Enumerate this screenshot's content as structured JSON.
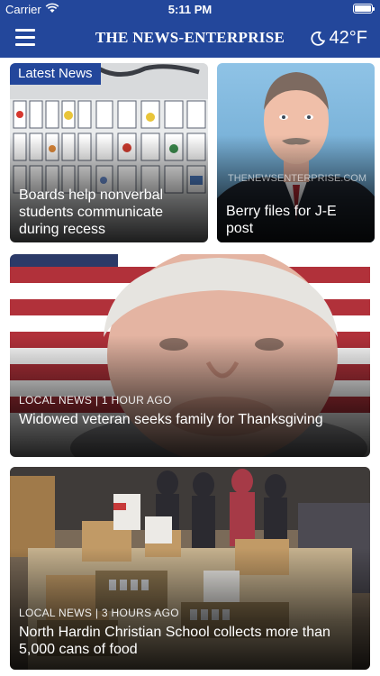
{
  "status_bar": {
    "carrier": "Carrier",
    "time": "5:11 PM"
  },
  "nav": {
    "brand": "THE NEWS-ENTERPRISE",
    "temperature": "42°F",
    "weather_icon": "moon-icon"
  },
  "stories": [
    {
      "badge": "Latest News",
      "headline": "Boards help nonverbal students communicate during recess"
    },
    {
      "headline": "Berry files for J-E post",
      "watermark": "THENEWSENTERPRISE.COM"
    },
    {
      "meta": "LOCAL NEWS | 1 HOUR AGO",
      "headline": "Widowed veteran seeks family for Thanksgiving"
    },
    {
      "meta": "LOCAL NEWS | 3 HOURS AGO",
      "headline": "North Hardin Christian School collects more than 5,000 cans of food"
    }
  ],
  "colors": {
    "brand_blue": "#23479b"
  }
}
